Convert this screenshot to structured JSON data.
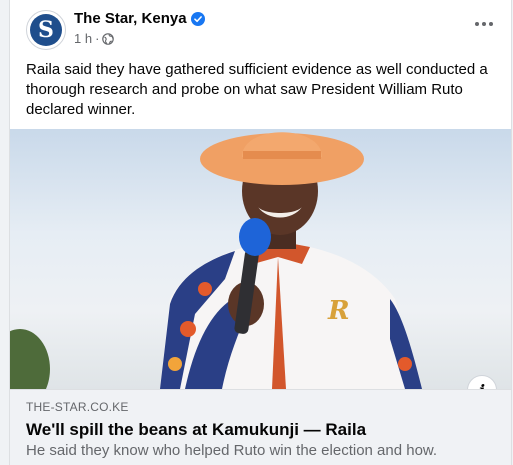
{
  "post": {
    "page_name": "The Star, Kenya",
    "avatar_letter": "S",
    "time": "1 h",
    "separator": "·",
    "text": "Raila said they have gathered sufficient evidence as well conducted a thorough research and probe on what saw President William Ruto declared winner."
  },
  "icons": {
    "verified": "verified-badge-icon",
    "audience": "globe-icon",
    "more": "more-options-icon",
    "info": "info-icon"
  },
  "link": {
    "domain": "THE-STAR.CO.KE",
    "title": "We'll spill the beans at Kamukunji — Raila",
    "description": "He said they know who helped Ruto win the election and how."
  },
  "colors": {
    "verified_blue": "#1877f2",
    "brand_blue": "#1f4e8c",
    "secondary_text": "#65676b"
  }
}
